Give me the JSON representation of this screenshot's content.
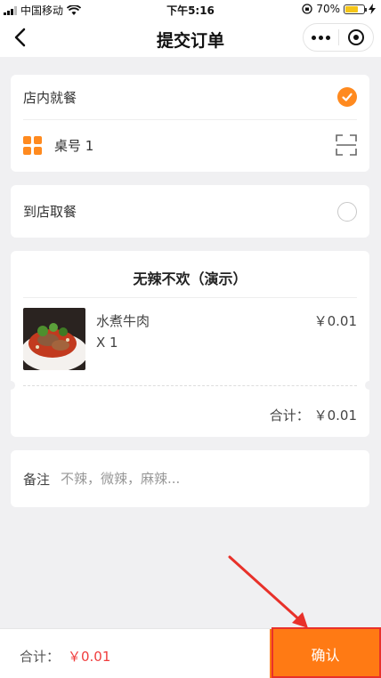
{
  "status_bar": {
    "carrier": "中国移动",
    "time": "下午5:16",
    "battery_pct": "70%",
    "battery_level": 0.7
  },
  "nav": {
    "title": "提交订单"
  },
  "dine_options": {
    "dine_in": {
      "label": "店内就餐",
      "selected": true
    },
    "table_label": "桌号 1",
    "takeout": {
      "label": "到店取餐",
      "selected": false
    }
  },
  "order": {
    "shop_name": "无辣不欢（演示）",
    "items": [
      {
        "name": "水煮牛肉",
        "qty": "X 1",
        "price": "￥0.01"
      }
    ],
    "subtotal_label": "合计：",
    "subtotal_value": "￥0.01"
  },
  "remark": {
    "label": "备注",
    "placeholder": "不辣，微辣，麻辣..."
  },
  "footer": {
    "total_label": "合计：",
    "total_value": "￥0.01",
    "confirm_label": "确认"
  },
  "colors": {
    "accent": "#ff8a1f",
    "confirm_bg": "#ff7a14",
    "price_red": "#f03d3d",
    "annotation_red": "#e8312a"
  }
}
